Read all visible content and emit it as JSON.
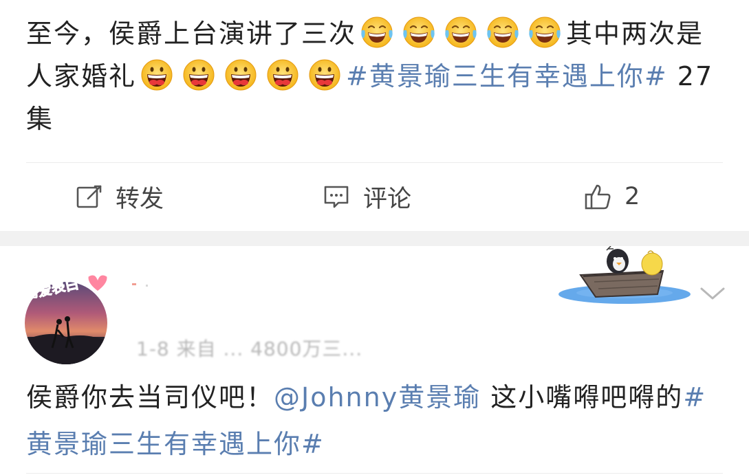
{
  "post1": {
    "text_a": "至今，侯爵上台演讲了三次",
    "text_b": "其中两次是人家婚礼",
    "topic": "#黄景瑜三生有幸遇上你#",
    "episode": " 27 集",
    "laugh_emoji_icon": "laughing-crying-face-icon",
    "grin_emoji_icon": "big-grin-face-icon"
  },
  "actions": {
    "repost_label": "转发",
    "comment_label": "评论",
    "like_count": "2"
  },
  "post2": {
    "meta": "1-8  来自 ... 4800万三...",
    "text_a": "侯爵你去当司仪吧！",
    "mention": "@Johnny黄景瑜",
    "text_b": " 这小嘴嘚吧嘚的",
    "topic": "#黄景瑜三生有幸遇上你#",
    "avatar_badge": "为爱表白"
  },
  "colors": {
    "link": "#5a7eb0",
    "text": "#222222",
    "separator": "#f1f1f1"
  }
}
